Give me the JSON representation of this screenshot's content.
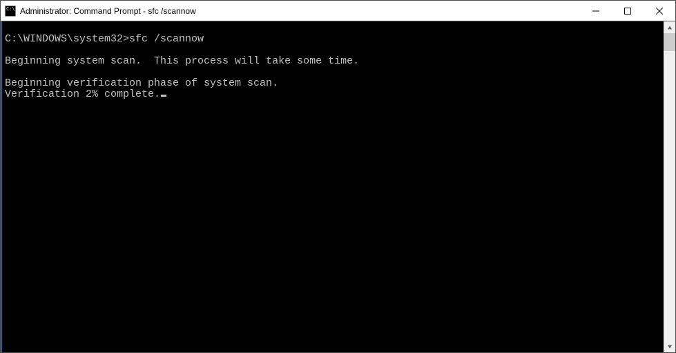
{
  "window": {
    "title": "Administrator: Command Prompt - sfc  /scannow"
  },
  "console": {
    "prompt_path": "C:\\WINDOWS\\system32>",
    "command": "sfc /scannow",
    "line_begin_scan": "Beginning system scan.  This process will take some time.",
    "line_begin_verify": "Beginning verification phase of system scan.",
    "line_progress": "Verification 2% complete."
  }
}
